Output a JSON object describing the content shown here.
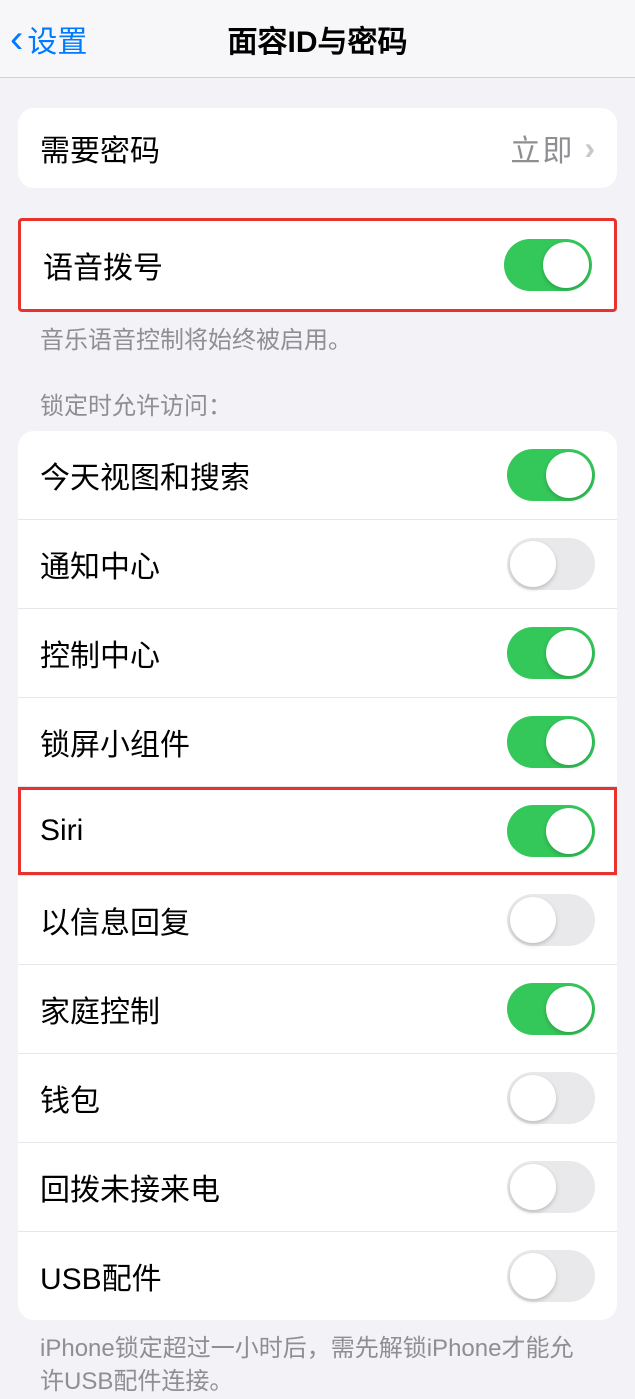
{
  "navbar": {
    "back_label": "设置",
    "title": "面容ID与密码"
  },
  "group_passcode": {
    "label": "需要密码",
    "value": "立即"
  },
  "group_voice": {
    "label": "语音拨号",
    "toggle": true,
    "footer": "音乐语音控制将始终被启用。"
  },
  "lockscreen_header": "锁定时允许访问：",
  "lockscreen_items": [
    {
      "label": "今天视图和搜索",
      "toggle": true
    },
    {
      "label": "通知中心",
      "toggle": false
    },
    {
      "label": "控制中心",
      "toggle": true
    },
    {
      "label": "锁屏小组件",
      "toggle": true
    },
    {
      "label": "Siri",
      "toggle": true
    },
    {
      "label": "以信息回复",
      "toggle": false
    },
    {
      "label": "家庭控制",
      "toggle": true
    },
    {
      "label": "钱包",
      "toggle": false
    },
    {
      "label": "回拨未接来电",
      "toggle": false
    },
    {
      "label": "USB配件",
      "toggle": false
    }
  ],
  "lockscreen_footer": "iPhone锁定超过一小时后，需先解锁iPhone才能允许USB配件连接。",
  "highlight_index": 4
}
